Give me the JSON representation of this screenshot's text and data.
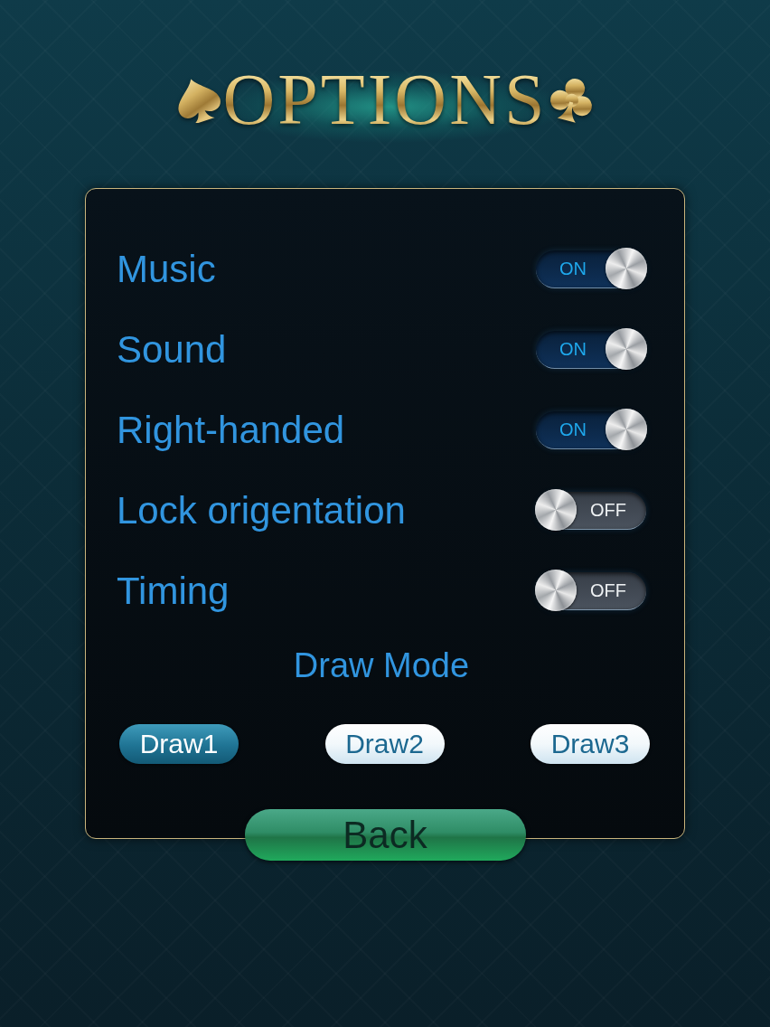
{
  "title": "OPTIONS",
  "settings": [
    {
      "label": "Music",
      "on": true,
      "switch_text": "ON"
    },
    {
      "label": "Sound",
      "on": true,
      "switch_text": "ON"
    },
    {
      "label": "Right-handed",
      "on": true,
      "switch_text": "ON"
    },
    {
      "label": "Lock origentation",
      "on": false,
      "switch_text": "OFF"
    },
    {
      "label": "Timing",
      "on": false,
      "switch_text": "OFF"
    }
  ],
  "draw_mode": {
    "heading": "Draw Mode",
    "options": [
      {
        "label": "Draw1",
        "selected": true
      },
      {
        "label": "Draw2",
        "selected": false
      },
      {
        "label": "Draw3",
        "selected": false
      }
    ]
  },
  "back_button": "Back"
}
